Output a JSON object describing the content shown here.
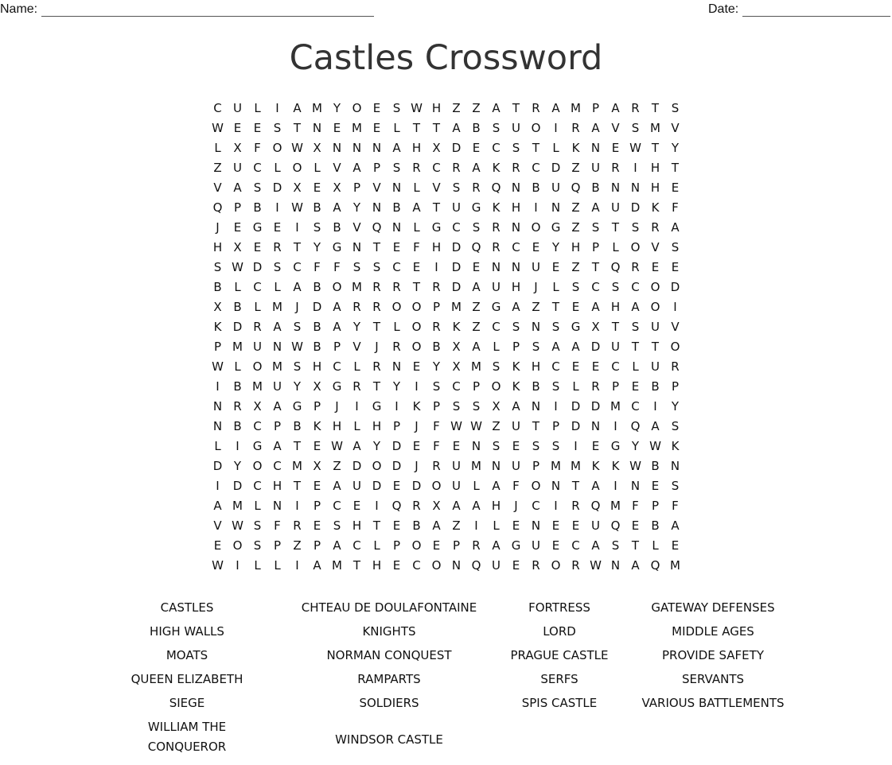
{
  "header": {
    "name_label": "Name:",
    "date_label": "Date:"
  },
  "title": "Castles Crossword",
  "grid": [
    "CULIAMYOESWHZZATRAMPARTS",
    "WEESTNEMELTTABSUOIRAVSMV",
    "LXFOWXNNNAHXDECSTLKNEWTY",
    "ZUCLOLVAPSRCRAKRCDZURIHT",
    "VASDXEXPVNLVSRQNBUQBNNHE",
    "QPBIWBAYNBATUGKHINZAUDKF",
    "JEGEISBVQNLGCSRNOGZSTSRA",
    "HXERTYGNTEFHDQRCEYHPLOVS",
    "SWDSCFFSSCEIDENNUEZTQREE",
    "BLCLABOMRRTRDAUHJLSCSCOD",
    "XBLMJDARROOPMZGAZTEAHAOI",
    "KDRASBAYTLORKZCSNSGXTSUV",
    "PMUNWBPVJROBXALPSAADUTTO",
    "WLOMSHCLRNEYXMSKHCEECLUR",
    "IBMUYXGRTYISCPOKBSLRPEBP",
    "NRXAGPJIGIKPSSXANIDDMCIY",
    "NBCPBKHLHPJFWWZUTPDNIQAS",
    "LIGATEWAYDEFENSESSIEGYWK",
    "DYOCMXZDODJRUMNUPMMKKWBN",
    "IDCHTEAUDEDOULAFONTAINES",
    "AMLNIPCEIQRXAAHJCIRQMFPF",
    "VWSFRESHTEBAZILENEEUQEBA",
    "EOSPZPACLPOEPRAGUECASTLE",
    "WILLIAMTHECONQUERORWNAQM"
  ],
  "word_list": [
    [
      "CASTLES",
      "CHTEAU DE DOULAFONTAINE",
      "FORTRESS",
      "GATEWAY DEFENSES"
    ],
    [
      "HIGH WALLS",
      "KNIGHTS",
      "LORD",
      "MIDDLE AGES"
    ],
    [
      "MOATS",
      "NORMAN CONQUEST",
      "PRAGUE CASTLE",
      "PROVIDE SAFETY"
    ],
    [
      "QUEEN ELIZABETH",
      "RAMPARTS",
      "SERFS",
      "SERVANTS"
    ],
    [
      "SIEGE",
      "SOLDIERS",
      "SPIS CASTLE",
      "VARIOUS BATTLEMENTS"
    ],
    [
      "WILLIAM THE CONQUEROR",
      "WINDSOR CASTLE"
    ]
  ]
}
